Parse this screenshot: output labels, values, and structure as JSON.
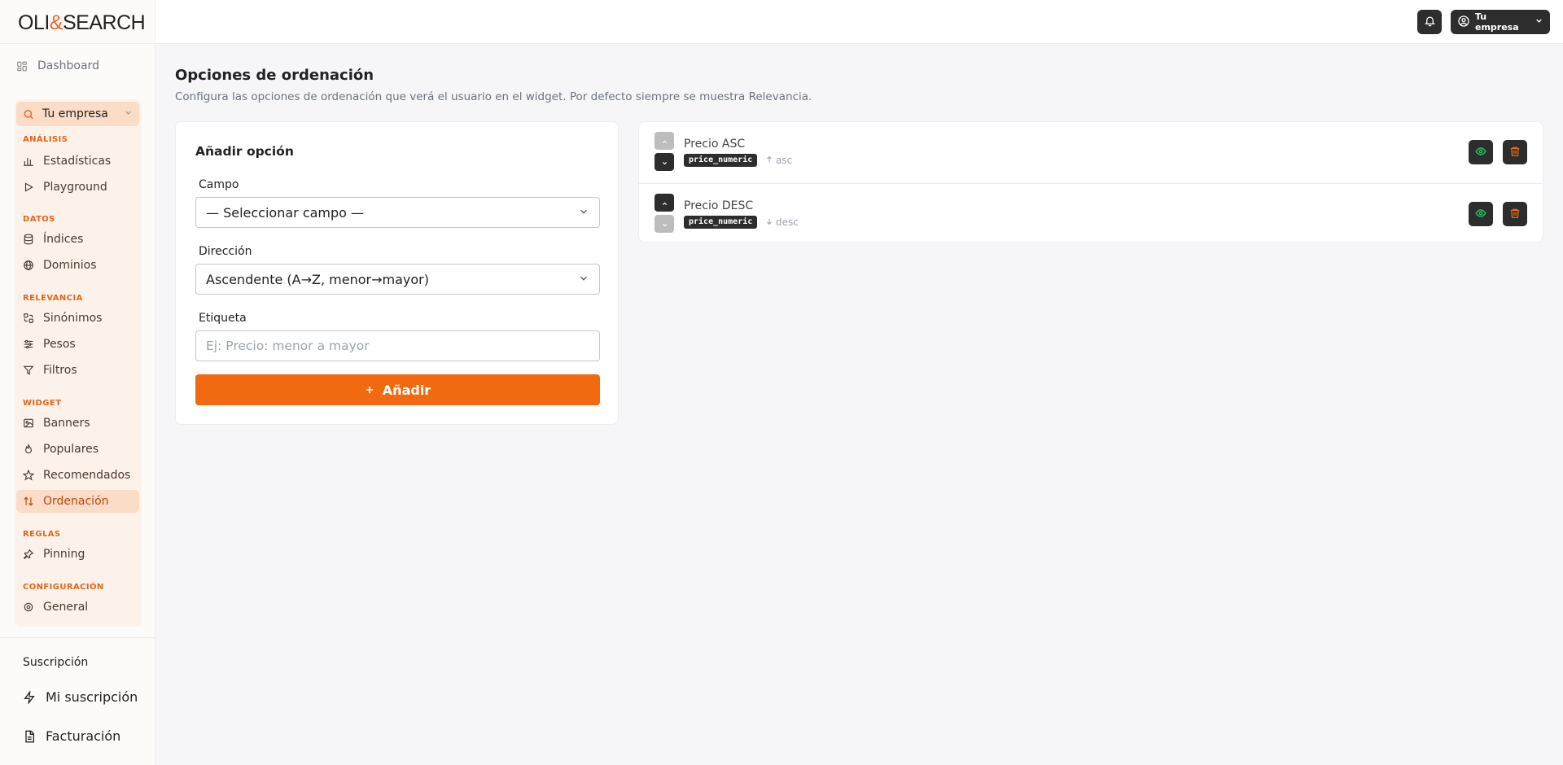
{
  "brand": {
    "logo_pre": "OLI",
    "logo_amp": "&",
    "logo_post": "SEARCH",
    "accent": "#f26a0f"
  },
  "sidebar": {
    "dashboard": "Dashboard",
    "company": "Tu empresa",
    "sections": {
      "analisis": "ANÁLISIS",
      "datos": "DATOS",
      "relevancia": "RELEVANCIA",
      "widget": "WIDGET",
      "reglas": "REGLAS",
      "configuracion": "CONFIGURACIÓN"
    },
    "items": {
      "estadisticas": "Estadísticas",
      "playground": "Playground",
      "indices": "Índices",
      "dominios": "Dominios",
      "sinonimos": "Sinónimos",
      "pesos": "Pesos",
      "filtros": "Filtros",
      "banners": "Banners",
      "populares": "Populares",
      "recomendados": "Recomendados",
      "ordenacion": "Ordenación",
      "pinning": "Pinning",
      "general": "General"
    },
    "subscription": {
      "title": "Suscripción",
      "mine": "Mi suscripción",
      "billing": "Facturación"
    }
  },
  "topbar": {
    "account": "Tu empresa"
  },
  "main": {
    "title": "Opciones de ordenación",
    "description": "Configura las opciones de ordenación que verá el usuario en el widget. Por defecto siempre se muestra Relevancia.",
    "form": {
      "title": "Añadir opción",
      "field_label": "Campo",
      "field_value": "— Seleccionar campo —",
      "direction_label": "Dirección",
      "direction_value": "Ascendente (A→Z, menor→mayor)",
      "tag_label": "Etiqueta",
      "tag_placeholder": "Ej: Precio: menor a mayor",
      "add_button": "Añadir"
    },
    "options": [
      {
        "label": "Precio ASC",
        "field": "price_numeric",
        "direction": "asc"
      },
      {
        "label": "Precio DESC",
        "field": "price_numeric",
        "direction": "desc"
      }
    ]
  }
}
